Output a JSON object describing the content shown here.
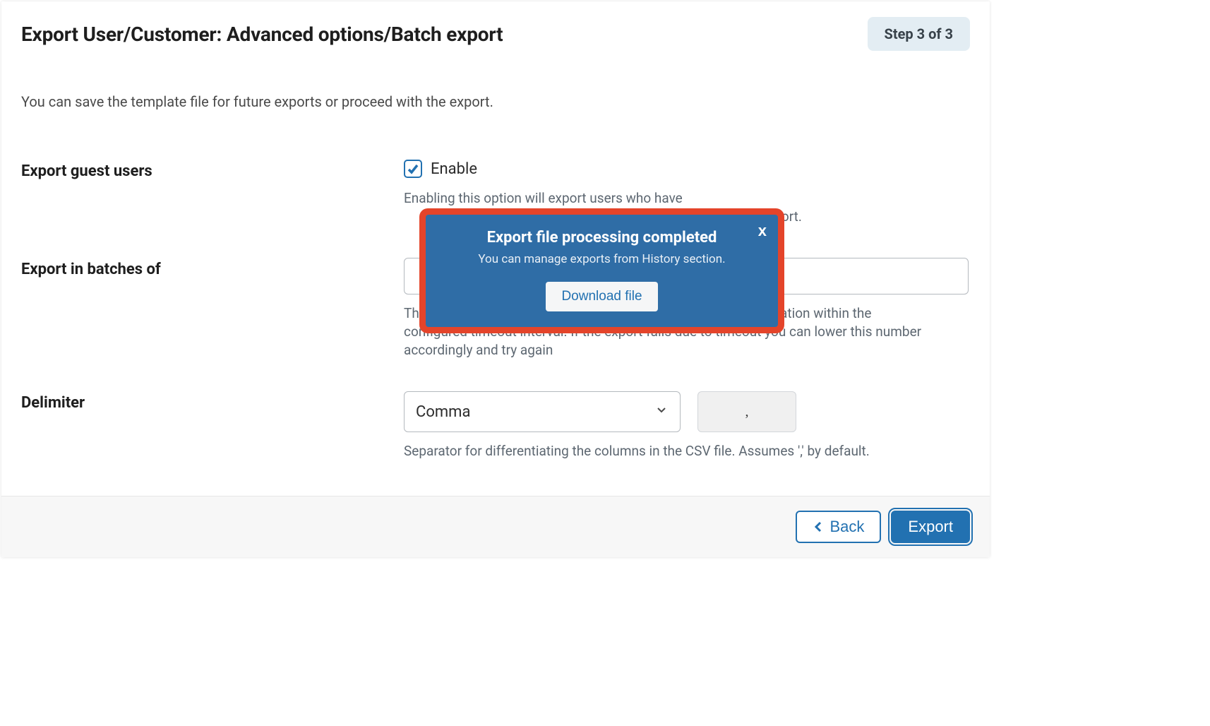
{
  "header": {
    "title": "Export User/Customer: Advanced options/Batch export",
    "step_badge": "Step 3 of 3"
  },
  "intro": "You can save the template file for future exports or proceed with the export.",
  "form": {
    "guest_users": {
      "label": "Export guest users",
      "checkbox_label": "Enable",
      "checkbox_checked": true,
      "help_partial": "Enabling this option will export users who have",
      "help_suffix": "export."
    },
    "batches": {
      "label": "Export in batches of",
      "value": "",
      "help": "The number of records that the server will process for every iteration within the configured timeout interval. If the export fails due to timeout you can lower this number accordingly and try again"
    },
    "delimiter": {
      "label": "Delimiter",
      "selected": "Comma",
      "preview": ",",
      "help": "Separator for differentiating the columns in the CSV file. Assumes ',' by default."
    }
  },
  "footer": {
    "back_label": "Back",
    "export_label": "Export"
  },
  "modal": {
    "close": "x",
    "title": "Export file processing completed",
    "subtitle": "You can manage exports from History section.",
    "button": "Download file"
  }
}
